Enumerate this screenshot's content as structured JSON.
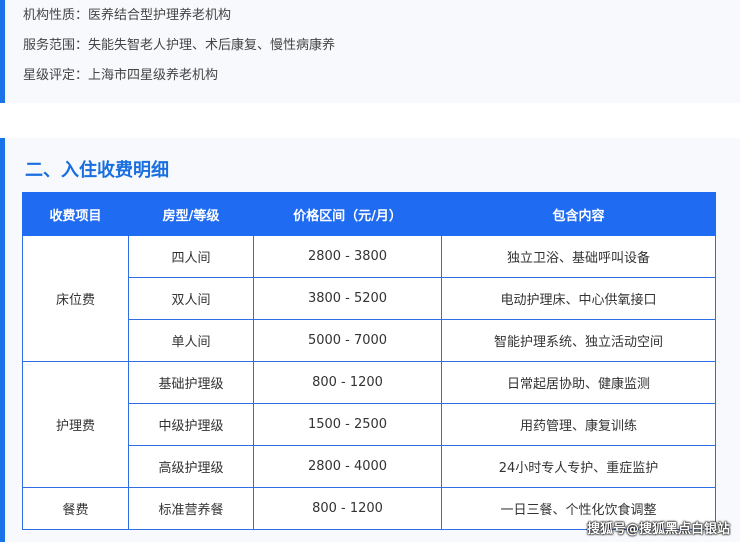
{
  "info": {
    "lines": [
      "机构性质：医养结合型护理养老机构",
      "服务范围：失能失智老人护理、术后康复、慢性病康养",
      "星级评定：上海市四星级养老机构"
    ]
  },
  "fees": {
    "title": "二、入住收费明细",
    "headers": [
      "收费项目",
      "房型/等级",
      "价格区间（元/月）",
      "包含内容"
    ],
    "groups": [
      {
        "category": "床位费",
        "rows": [
          {
            "type": "四人间",
            "price": "2800 - 3800",
            "content": "独立卫浴、基础呼叫设备"
          },
          {
            "type": "双人间",
            "price": "3800 - 5200",
            "content": "电动护理床、中心供氧接口"
          },
          {
            "type": "单人间",
            "price": "5000 - 7000",
            "content": "智能护理系统、独立活动空间"
          }
        ]
      },
      {
        "category": "护理费",
        "rows": [
          {
            "type": "基础护理级",
            "price": "800 - 1200",
            "content": "日常起居协助、健康监测"
          },
          {
            "type": "中级护理级",
            "price": "1500 - 2500",
            "content": "用药管理、康复训练"
          },
          {
            "type": "高级护理级",
            "price": "2800 - 4000",
            "content": "24小时专人专护、重症监护"
          }
        ]
      },
      {
        "category": "餐费",
        "rows": [
          {
            "type": "标准营养餐",
            "price": "800 - 1200",
            "content": "一日三餐、个性化饮食调整"
          }
        ]
      }
    ]
  },
  "watermark": "搜狐号@搜狐黑点白银站",
  "colors": {
    "accent": "#1a73e8",
    "header_bg": "#1f6cf2",
    "border": "#2f6fe6",
    "title": "#1a6fe0"
  }
}
